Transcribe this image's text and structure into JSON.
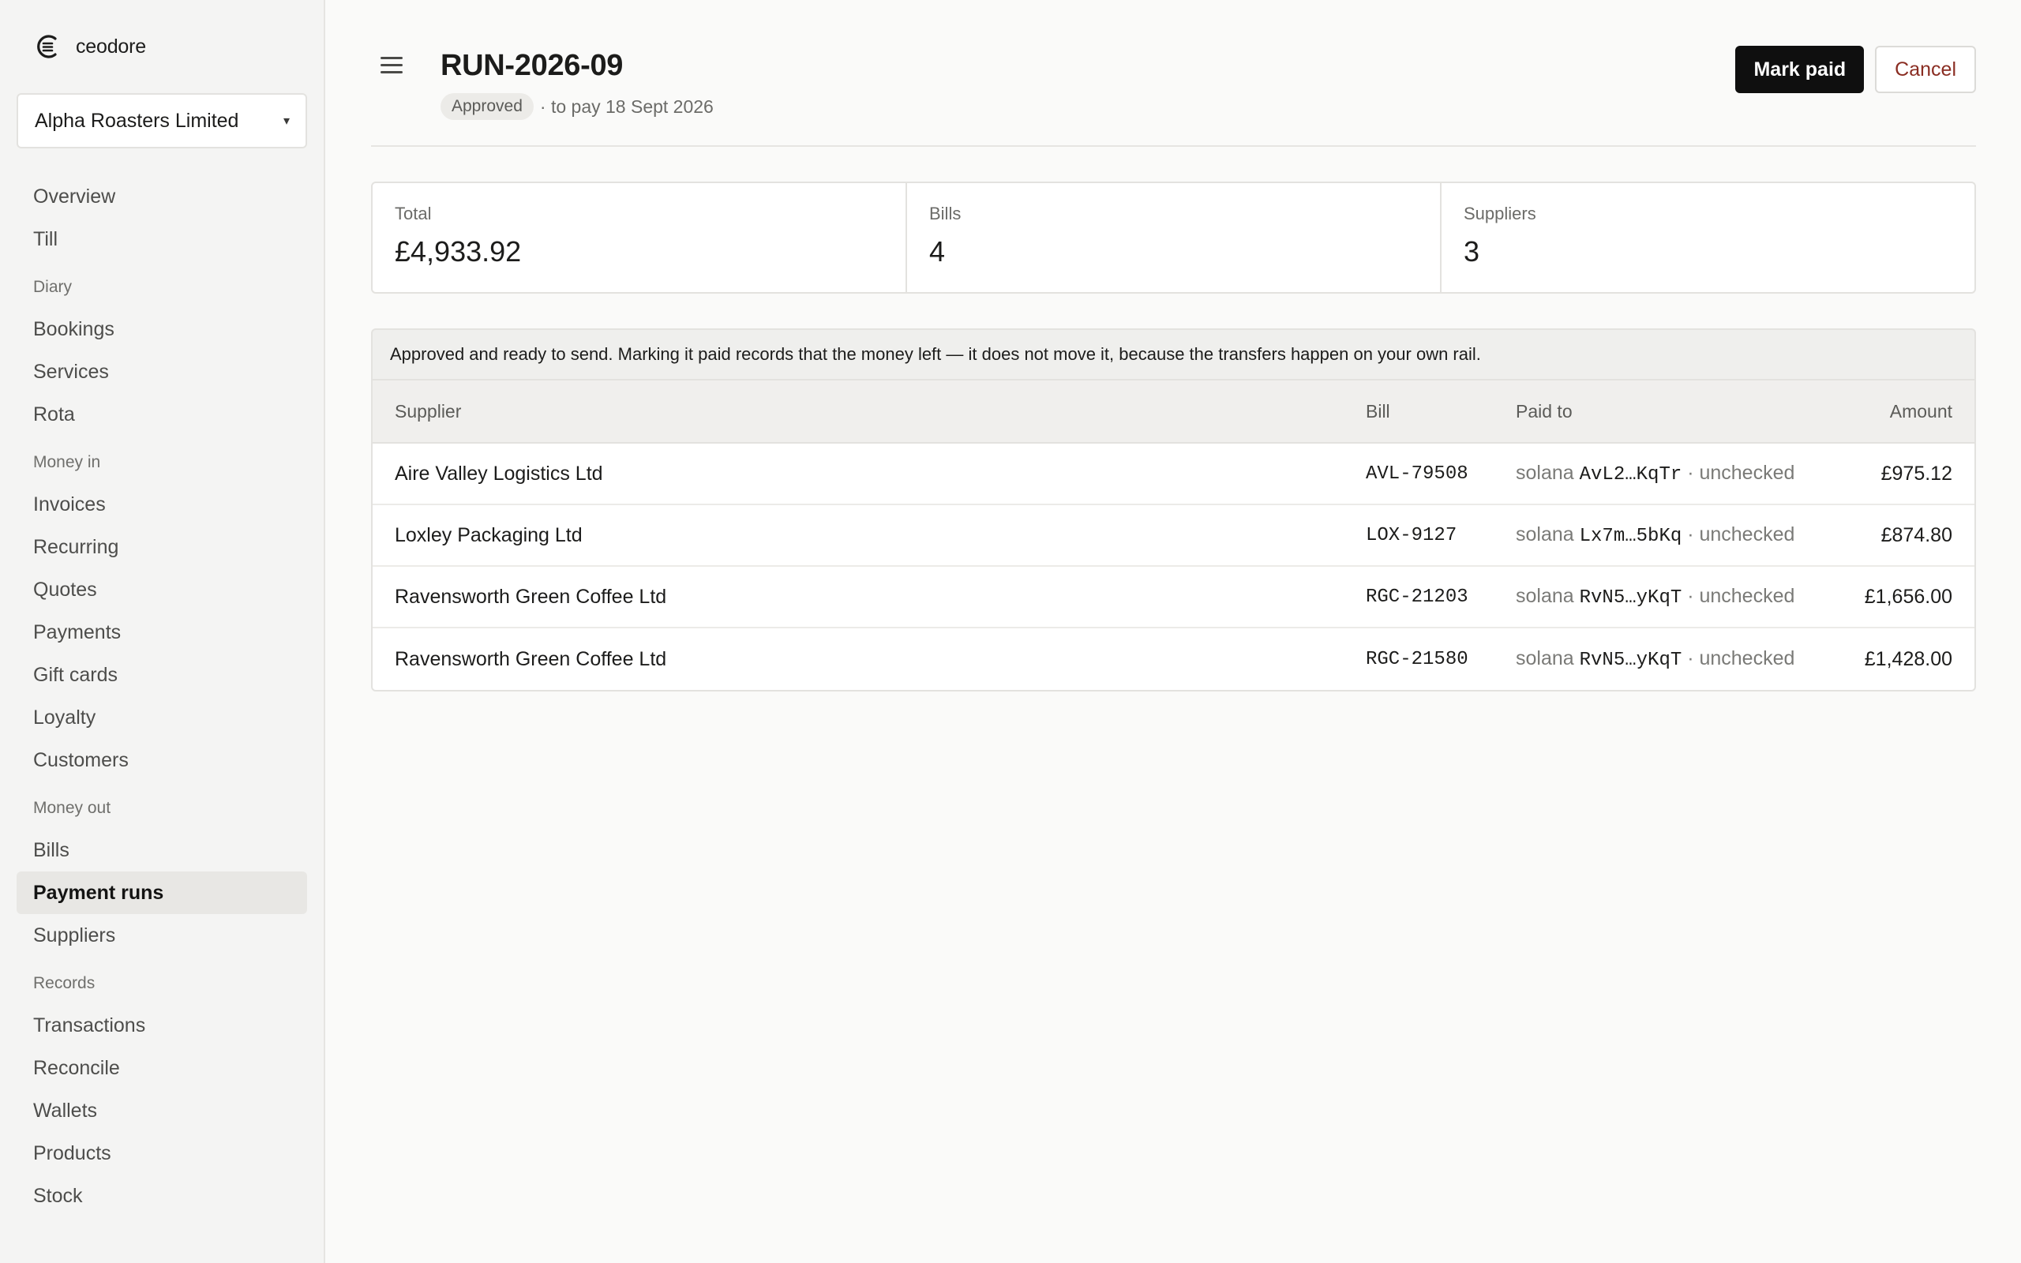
{
  "brand": {
    "name": "ceodore"
  },
  "org": {
    "name": "Alpha Roasters Limited",
    "caret": "▾"
  },
  "nav": {
    "top": [
      "Overview",
      "Till"
    ],
    "diary": {
      "label": "Diary",
      "items": [
        "Bookings",
        "Services",
        "Rota"
      ]
    },
    "money_in": {
      "label": "Money in",
      "items": [
        "Invoices",
        "Recurring",
        "Quotes",
        "Payments",
        "Gift cards",
        "Loyalty",
        "Customers"
      ]
    },
    "money_out": {
      "label": "Money out",
      "items": [
        "Bills",
        "Payment runs",
        "Suppliers"
      ],
      "active": "Payment runs"
    },
    "records": {
      "label": "Records",
      "items": [
        "Transactions",
        "Reconcile",
        "Wallets",
        "Products",
        "Stock"
      ]
    }
  },
  "header": {
    "title": "RUN-2026-09",
    "status": "Approved",
    "pay_date": "· to pay 18 Sept 2026",
    "mark_paid_label": "Mark paid",
    "cancel_label": "Cancel"
  },
  "stats": [
    {
      "label": "Total",
      "value": "£4,933.92"
    },
    {
      "label": "Bills",
      "value": "4"
    },
    {
      "label": "Suppliers",
      "value": "3"
    }
  ],
  "notice": "Approved and ready to send. Marking it paid records that the money left — it does not move it, because the transfers happen on your own rail.",
  "table": {
    "headers": {
      "supplier": "Supplier",
      "bill": "Bill",
      "paid_to": "Paid to",
      "amount": "Amount"
    },
    "rows": [
      {
        "supplier": "Aire Valley Logistics Ltd",
        "bill": "AVL-79508",
        "chain": "solana",
        "address": "AvL2…KqTr",
        "check": "· unchecked",
        "amount": "£975.12"
      },
      {
        "supplier": "Loxley Packaging Ltd",
        "bill": "LOX-9127",
        "chain": "solana",
        "address": "Lx7m…5bKq",
        "check": "· unchecked",
        "amount": "£874.80"
      },
      {
        "supplier": "Ravensworth Green Coffee Ltd",
        "bill": "RGC-21203",
        "chain": "solana",
        "address": "RvN5…yKqT",
        "check": "· unchecked",
        "amount": "£1,656.00"
      },
      {
        "supplier": "Ravensworth Green Coffee Ltd",
        "bill": "RGC-21580",
        "chain": "solana",
        "address": "RvN5…yKqT",
        "check": "· unchecked",
        "amount": "£1,428.00"
      }
    ]
  }
}
